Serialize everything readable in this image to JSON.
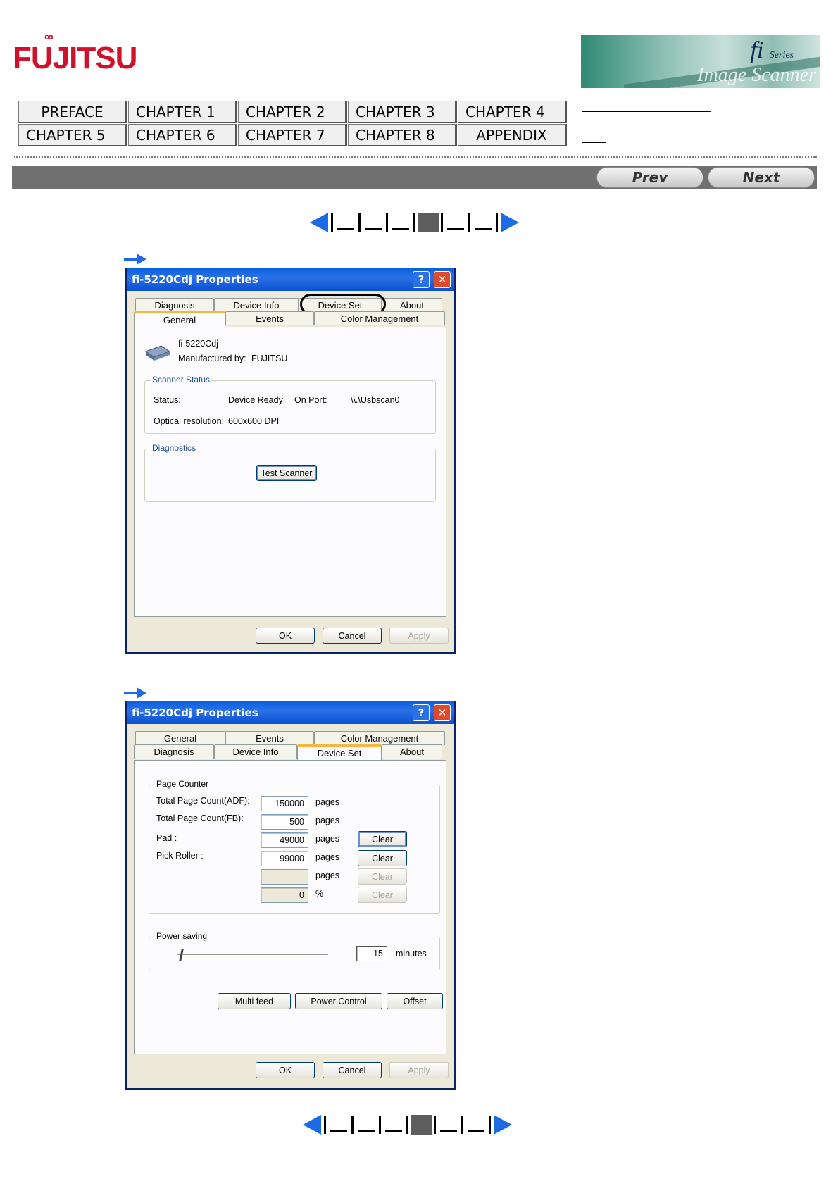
{
  "header": {
    "logo_text": "FUJITSU",
    "banner_brand": "fi",
    "banner_brand_sub": "Series",
    "banner_script": "Image Scanner"
  },
  "chapters": [
    "PREFACE",
    "CHAPTER 1",
    "CHAPTER 2",
    "CHAPTER 3",
    "CHAPTER 4",
    "CHAPTER 5",
    "CHAPTER 6",
    "CHAPTER 7",
    "CHAPTER 8",
    "APPENDIX"
  ],
  "nav": {
    "prev_label": "Prev",
    "next_label": "Next"
  },
  "pager": {
    "current_page": 4,
    "total_pages": 6
  },
  "dialog1": {
    "title": "fi-5220Cdj Properties",
    "tabs_back": [
      "Diagnosis",
      "Device Info",
      "Device Set",
      "About"
    ],
    "tabs_front": [
      "General",
      "Events",
      "Color Management"
    ],
    "active_tab": "General",
    "device_name": "fi-5220Cdj",
    "manufacturer_label": "Manufactured by:",
    "manufacturer": "FUJITSU",
    "scanner_status_group": "Scanner Status",
    "status_label": "Status:",
    "status_value": "Device Ready",
    "port_label": "On Port:",
    "port_value": "\\\\.\\Usbscan0",
    "resolution_label": "Optical resolution:",
    "resolution_value": "600x600 DPI",
    "diagnostics_group": "Diagnostics",
    "test_button": "Test Scanner",
    "ok": "OK",
    "cancel": "Cancel",
    "apply": "Apply"
  },
  "dialog2": {
    "title": "fi-5220Cdj Properties",
    "tabs_back": [
      "General",
      "Events",
      "Color Management"
    ],
    "tabs_front": [
      "Diagnosis",
      "Device Info",
      "Device Set",
      "About"
    ],
    "active_tab": "Device Set",
    "page_counter_group": "Page Counter",
    "rows": [
      {
        "label": "Total Page Count(ADF):",
        "value": "150000",
        "unit": "pages",
        "button": ""
      },
      {
        "label": "Total Page Count(FB):",
        "value": "500",
        "unit": "pages",
        "button": ""
      },
      {
        "label": "Pad :",
        "value": "49000",
        "unit": "pages",
        "button": "Clear"
      },
      {
        "label": "Pick Roller :",
        "value": "99000",
        "unit": "pages",
        "button": "Clear"
      },
      {
        "label": "",
        "value": "",
        "unit": "pages",
        "button": "Clear"
      },
      {
        "label": "",
        "value": "0",
        "unit": "%",
        "button": "Clear"
      }
    ],
    "power_saving_group": "Power saving",
    "power_minutes": "15",
    "minutes_label": "minutes",
    "slider_level": 0.02,
    "multi_feed": "Multi feed",
    "power_control": "Power Control",
    "offset": "Offset",
    "ok": "OK",
    "cancel": "Cancel",
    "apply": "Apply"
  },
  "colors": {
    "accent_blue": "#1d6ae5",
    "title_bar": "#0a5fe0",
    "logo_red": "#d0112b",
    "nav_bar": "#707070"
  }
}
